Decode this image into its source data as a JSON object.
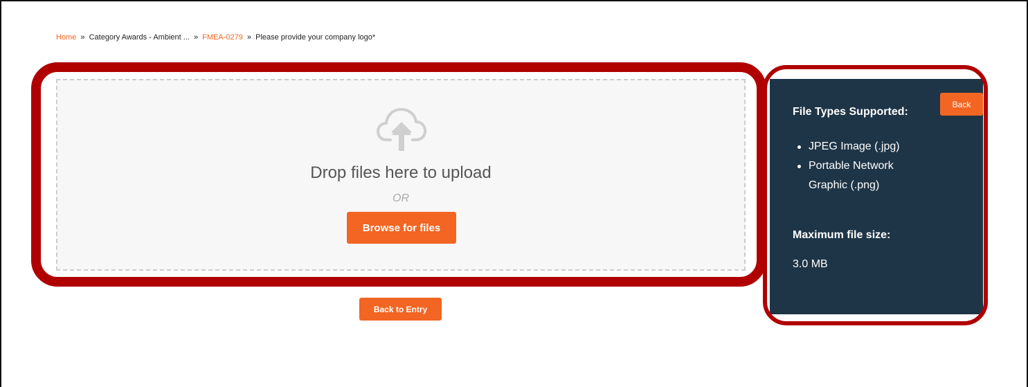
{
  "breadcrumb": {
    "home": "Home",
    "sep1": "»",
    "category": "Category Awards - Ambient ...",
    "sep2": "»",
    "entry_id": "FMEA-0279",
    "sep3": "»",
    "current": "Please provide your company logo*"
  },
  "dropzone": {
    "icon": "cloud-upload-icon",
    "drop_text": "Drop files here to upload",
    "or_text": "OR",
    "browse_label": "Browse for files"
  },
  "actions": {
    "back_to_entry_label": "Back to Entry"
  },
  "info_panel": {
    "back_label": "Back",
    "file_types_heading": "File Types Supported:",
    "file_types": [
      "JPEG Image (.jpg)",
      "Portable Network Graphic (.png)"
    ],
    "max_size_heading": "Maximum file size:",
    "max_size_value": "3.0 MB"
  },
  "colors": {
    "accent": "#f26522",
    "panel_bg": "#1e3547",
    "highlight": "#b00000"
  }
}
